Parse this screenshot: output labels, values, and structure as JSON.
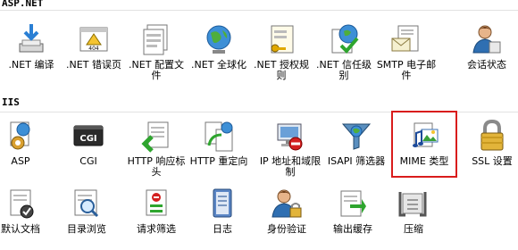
{
  "sections": {
    "aspnet": {
      "title": "ASP.NET"
    },
    "iis": {
      "title": "IIS"
    }
  },
  "aspnet_items": [
    {
      "label": ".NET 编译",
      "icon": "compile-icon"
    },
    {
      "label": ".NET 错误页",
      "icon": "error-page-404-icon"
    },
    {
      "label": ".NET 配置文件",
      "icon": "config-file-icon"
    },
    {
      "label": ".NET 全球化",
      "icon": "globe-icon"
    },
    {
      "label": ".NET 授权规则",
      "icon": "authorization-rules-icon"
    },
    {
      "label": ".NET 信任级别",
      "icon": "trust-level-icon"
    },
    {
      "label": "SMTP 电子邮件",
      "icon": "smtp-email-icon"
    },
    {
      "label": "会话状态",
      "icon": "session-state-icon"
    }
  ],
  "iis_items": [
    {
      "label": "ASP",
      "icon": "asp-icon"
    },
    {
      "label": "CGI",
      "icon": "cgi-icon"
    },
    {
      "label": "HTTP 响应标头",
      "icon": "http-response-headers-icon"
    },
    {
      "label": "HTTP 重定向",
      "icon": "http-redirect-icon"
    },
    {
      "label": "IP 地址和域限制",
      "icon": "ip-restrictions-icon"
    },
    {
      "label": "ISAPI 筛选器",
      "icon": "isapi-filters-icon"
    },
    {
      "label": "MIME 类型",
      "icon": "mime-types-icon",
      "selected": true
    },
    {
      "label": "SSL 设置",
      "icon": "ssl-lock-icon"
    }
  ],
  "iis_items_row2": [
    {
      "label": "默认文档",
      "icon": "default-document-icon"
    },
    {
      "label": "目录浏览",
      "icon": "directory-browsing-icon"
    },
    {
      "label": "请求筛选",
      "icon": "request-filtering-icon"
    },
    {
      "label": "日志",
      "icon": "logging-icon"
    },
    {
      "label": "身份验证",
      "icon": "authentication-icon"
    },
    {
      "label": "输出缓存",
      "icon": "output-caching-icon"
    },
    {
      "label": "压缩",
      "icon": "compression-icon"
    }
  ]
}
